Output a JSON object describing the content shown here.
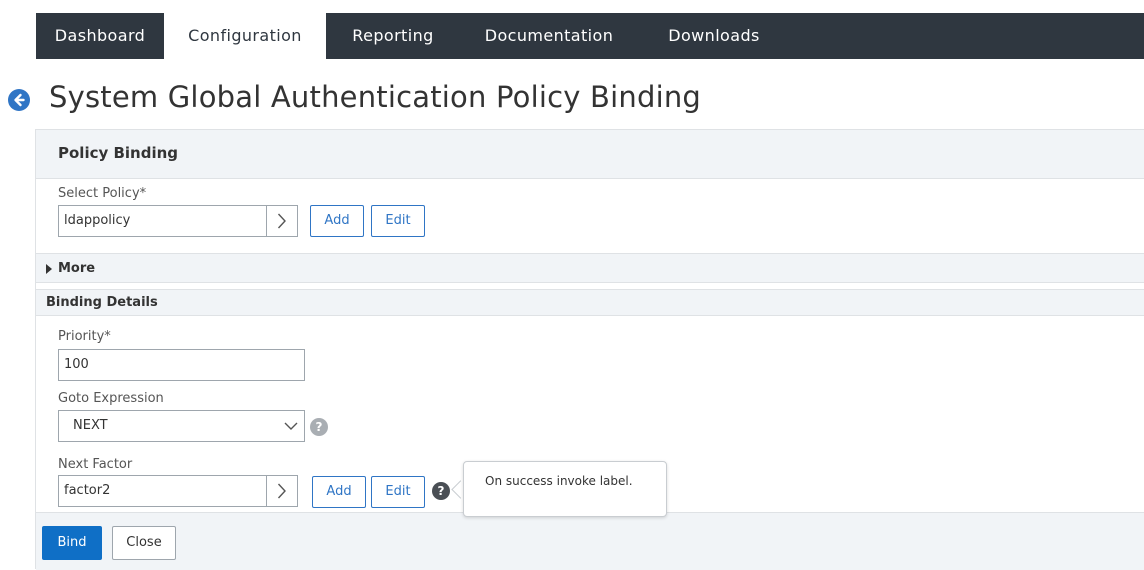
{
  "nav": {
    "tabs": [
      {
        "label": "Dashboard"
      },
      {
        "label": "Configuration",
        "active": true
      },
      {
        "label": "Reporting"
      },
      {
        "label": "Documentation"
      },
      {
        "label": "Downloads"
      }
    ]
  },
  "page": {
    "title": "System Global Authentication Policy Binding",
    "back_icon": "arrow-left-circle-icon"
  },
  "panel": {
    "header": "Policy Binding",
    "select_policy": {
      "label": "Select Policy*",
      "value": "ldappolicy",
      "add_label": "Add",
      "edit_label": "Edit"
    },
    "more_label": "More",
    "binding_details": {
      "header": "Binding Details",
      "priority_label": "Priority*",
      "priority_value": "100",
      "goto_label": "Goto Expression",
      "goto_value": "NEXT",
      "next_factor_label": "Next Factor",
      "next_factor_value": "factor2",
      "add_label": "Add",
      "edit_label": "Edit",
      "help_tooltip": "On success invoke label."
    },
    "buttons": {
      "bind": "Bind",
      "close": "Close"
    }
  },
  "colors": {
    "nav_bg": "#2f3740",
    "accent": "#2f75c5",
    "primary_button": "#0f6fc6",
    "panel_header_bg": "#f1f4f7",
    "help_icon_dark": "#4a4f55",
    "help_icon_light": "#a9aeb3"
  }
}
